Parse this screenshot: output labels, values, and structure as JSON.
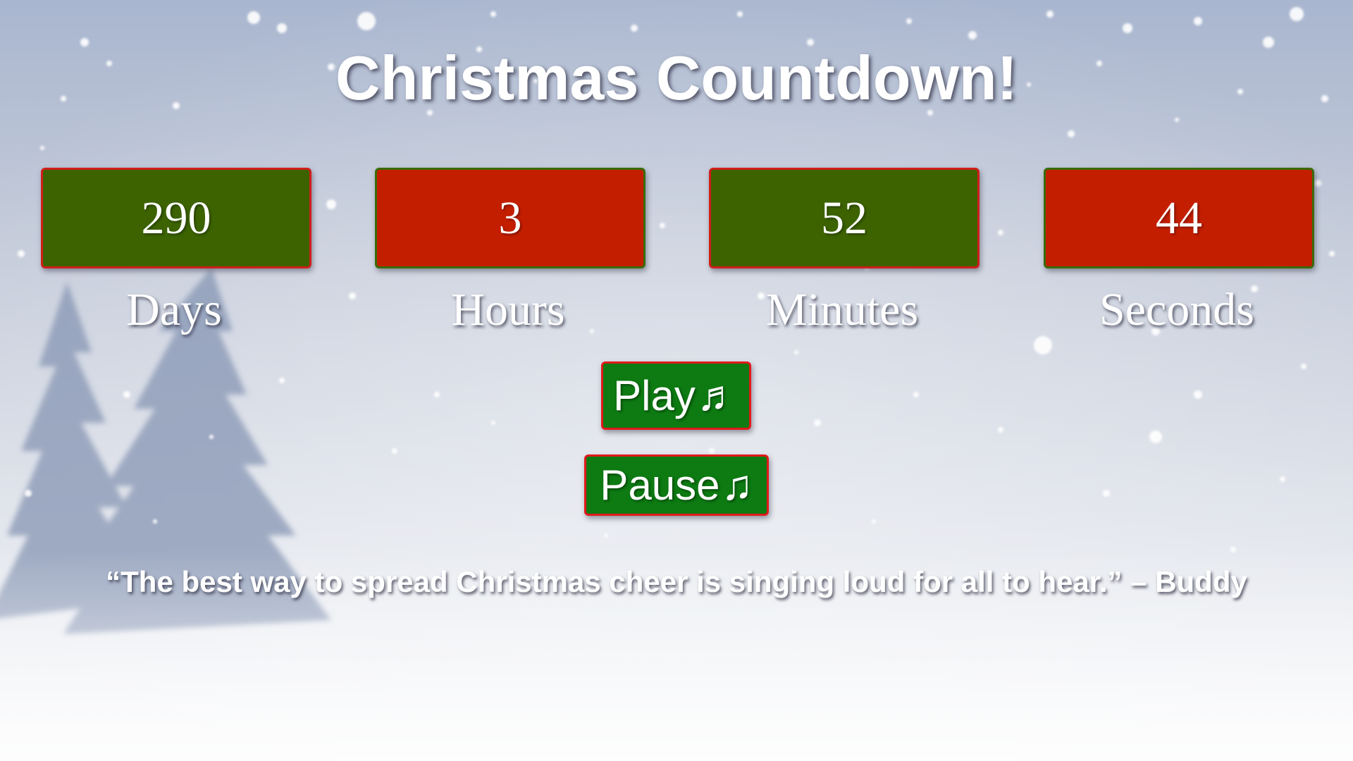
{
  "page": {
    "title": "Christmas Countdown!"
  },
  "countdown": [
    {
      "value": "290",
      "label": "Days",
      "color": "#3c6300"
    },
    {
      "value": "3",
      "label": "Hours",
      "color": "#c41e00"
    },
    {
      "value": "52",
      "label": "Minutes",
      "color": "#3c6300"
    },
    {
      "value": "44",
      "label": "Seconds",
      "color": "#c41e00"
    }
  ],
  "controls": {
    "play_label": "Play",
    "play_icon": "♬",
    "pause_label": "Pause",
    "pause_icon": "♫"
  },
  "quote": {
    "text": "“The best way to spread Christmas cheer is singing loud for all to hear.” – Buddy"
  },
  "theme": {
    "button_bg": "#0d7a12",
    "button_border": "#e01a1a",
    "text": "#ffffff",
    "background": "snowy winter scene with pine trees"
  }
}
